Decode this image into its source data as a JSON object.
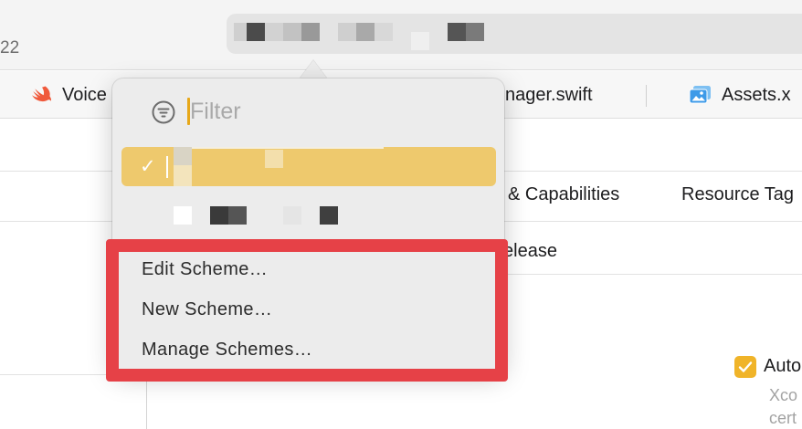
{
  "window": {
    "build_number": "22"
  },
  "tabs": [
    {
      "label": "Voice",
      "icon": "swift-icon"
    },
    {
      "label": "nager.swift"
    },
    {
      "label": "Assets.x",
      "icon": "assets-catalog-icon"
    }
  ],
  "settings_tabs": [
    {
      "label": "& Capabilities"
    },
    {
      "label": "Resource Tag"
    }
  ],
  "content": {
    "release_label": "elease",
    "auto_label": "Auto",
    "hint_line1": "Xco",
    "hint_line2": "cert",
    "auto_checked": true
  },
  "popover": {
    "filter": {
      "placeholder": "Filter",
      "value": "",
      "icon": "filter-icon"
    },
    "schemes": [
      {
        "selected": true,
        "check": "✓"
      },
      {
        "selected": false,
        "check": ""
      }
    ],
    "menu": {
      "edit": "Edit Scheme…",
      "new": "New Scheme…",
      "manage": "Manage Schemes…"
    }
  },
  "colors": {
    "selection": "#eec96d",
    "highlight_border": "#e64147",
    "accent": "#f0b429"
  }
}
